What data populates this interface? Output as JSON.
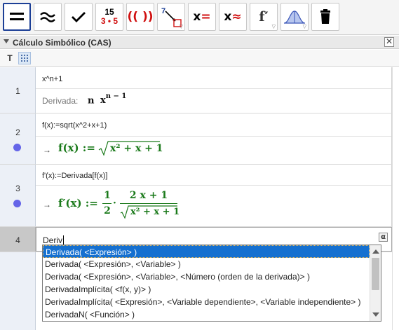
{
  "toolbar": {
    "tools": [
      {
        "name": "evaluate",
        "icon": "equals-icon",
        "selected": true
      },
      {
        "name": "numeric",
        "icon": "approx-icon"
      },
      {
        "name": "keep-input",
        "icon": "checkmark-icon"
      },
      {
        "name": "factor",
        "icon": "factor-icon",
        "top": "15",
        "bottom": "3 • 5"
      },
      {
        "name": "expand",
        "icon": "parentheses-icon",
        "label": "(( ))"
      },
      {
        "name": "substitute",
        "icon": "substitute-icon",
        "label": "7"
      },
      {
        "name": "solve",
        "icon": "solve-icon",
        "label": "x ="
      },
      {
        "name": "solve-numerically",
        "icon": "solve-numerically-icon",
        "label": "x ≈"
      },
      {
        "name": "derivative",
        "icon": "derivative-icon",
        "label": "f′"
      },
      {
        "name": "probability",
        "icon": "probability-curve-icon"
      },
      {
        "name": "delete",
        "icon": "trash-icon"
      }
    ]
  },
  "panel": {
    "title": "Cálculo Simbólico (CAS)",
    "close": "✕"
  },
  "stylebar": {
    "text_button": "T"
  },
  "rows": [
    {
      "number": "1",
      "input": "x^n+1",
      "output_label": "Derivada:",
      "output": {
        "coef": "n",
        "base": "x",
        "exp": "n − 1"
      }
    },
    {
      "number": "2",
      "input": "f(x):=sqrt(x^2+x+1)",
      "output_arrow": "→",
      "output": {
        "lhs": "f(x) :=",
        "radicand": "x² + x + 1"
      }
    },
    {
      "number": "3",
      "input": "f'(x):=Derivada[f(x)]",
      "output_arrow": "→",
      "output": {
        "lhs": "f′(x) :=",
        "frac1_num": "1",
        "frac1_den": "2",
        "dot": "·",
        "frac2_num": "2 x + 1",
        "frac2_den": "x² + x + 1"
      }
    },
    {
      "number": "4",
      "input": "Deriv",
      "alpha": "α"
    }
  ],
  "suggestions": [
    "Derivada( <Expresión> )",
    "Derivada( <Expresión>, <Variable> )",
    "Derivada( <Expresión>, <Variable>, <Número (orden de la derivada)> )",
    "DerivadaImplícita( <f(x, y)> )",
    "DerivadaImplícita( <Expresión>, <Variable dependiente>, <Variable independiente> )",
    "DerivadaN( <Función> )"
  ],
  "colors": {
    "accent": "#1c3f96",
    "output_green": "#1b7a1b",
    "selection": "#1570d0",
    "marker": "#6565e8"
  }
}
